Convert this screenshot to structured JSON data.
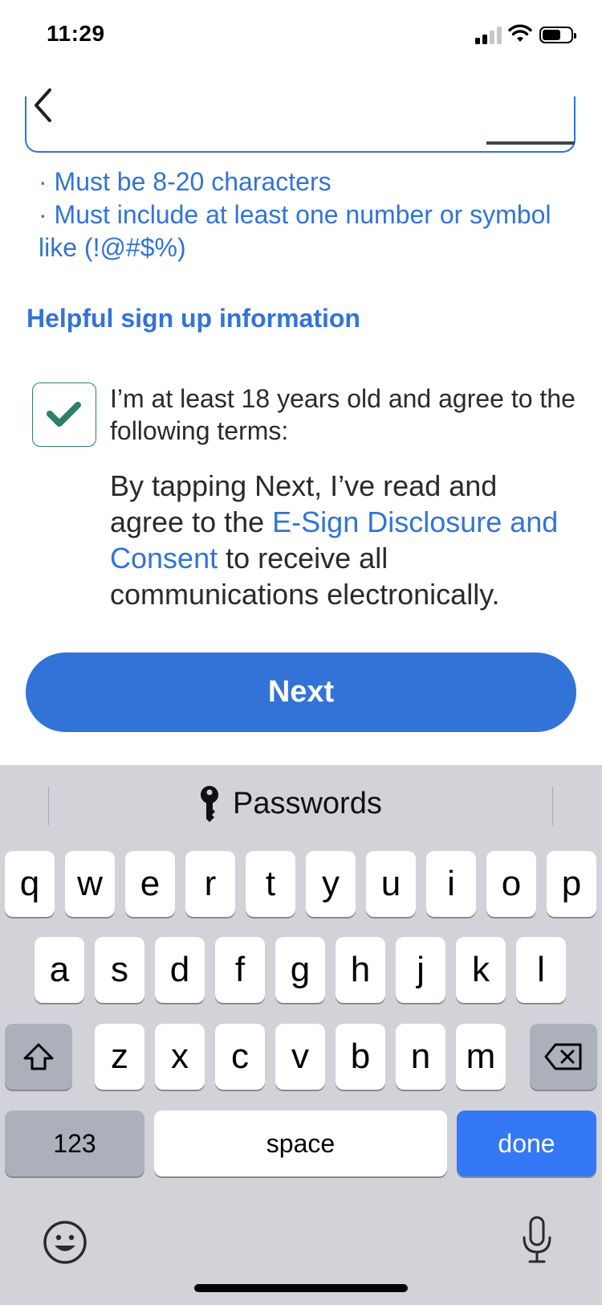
{
  "status_bar": {
    "time": "11:29"
  },
  "password_rules": [
    "· Must be 8-20 characters",
    "· Must include at least one number or symbol like (!@#$%)"
  ],
  "helpful_link": "Helpful sign up information",
  "age_checkbox": {
    "checked": true,
    "label": "I’m at least 18 years old and agree to the following terms:"
  },
  "consent": {
    "prefix": "By tapping Next, I’ve read and agree to the ",
    "link": "E-Sign Disclosure and Consent",
    "suffix": " to receive all communications electronically."
  },
  "next_button": "Next",
  "keyboard": {
    "suggestion": "Passwords",
    "row1": [
      "q",
      "w",
      "e",
      "r",
      "t",
      "y",
      "u",
      "i",
      "o",
      "p"
    ],
    "row2": [
      "a",
      "s",
      "d",
      "f",
      "g",
      "h",
      "j",
      "k",
      "l"
    ],
    "row3": [
      "z",
      "x",
      "c",
      "v",
      "b",
      "n",
      "m"
    ],
    "numbers_key": "123",
    "space_key": "space",
    "done_key": "done"
  },
  "colors": {
    "accent": "#3273d8",
    "check": "#2f7d6a",
    "keyboard_bg": "#d1d3d9",
    "done_key": "#3478f6"
  }
}
